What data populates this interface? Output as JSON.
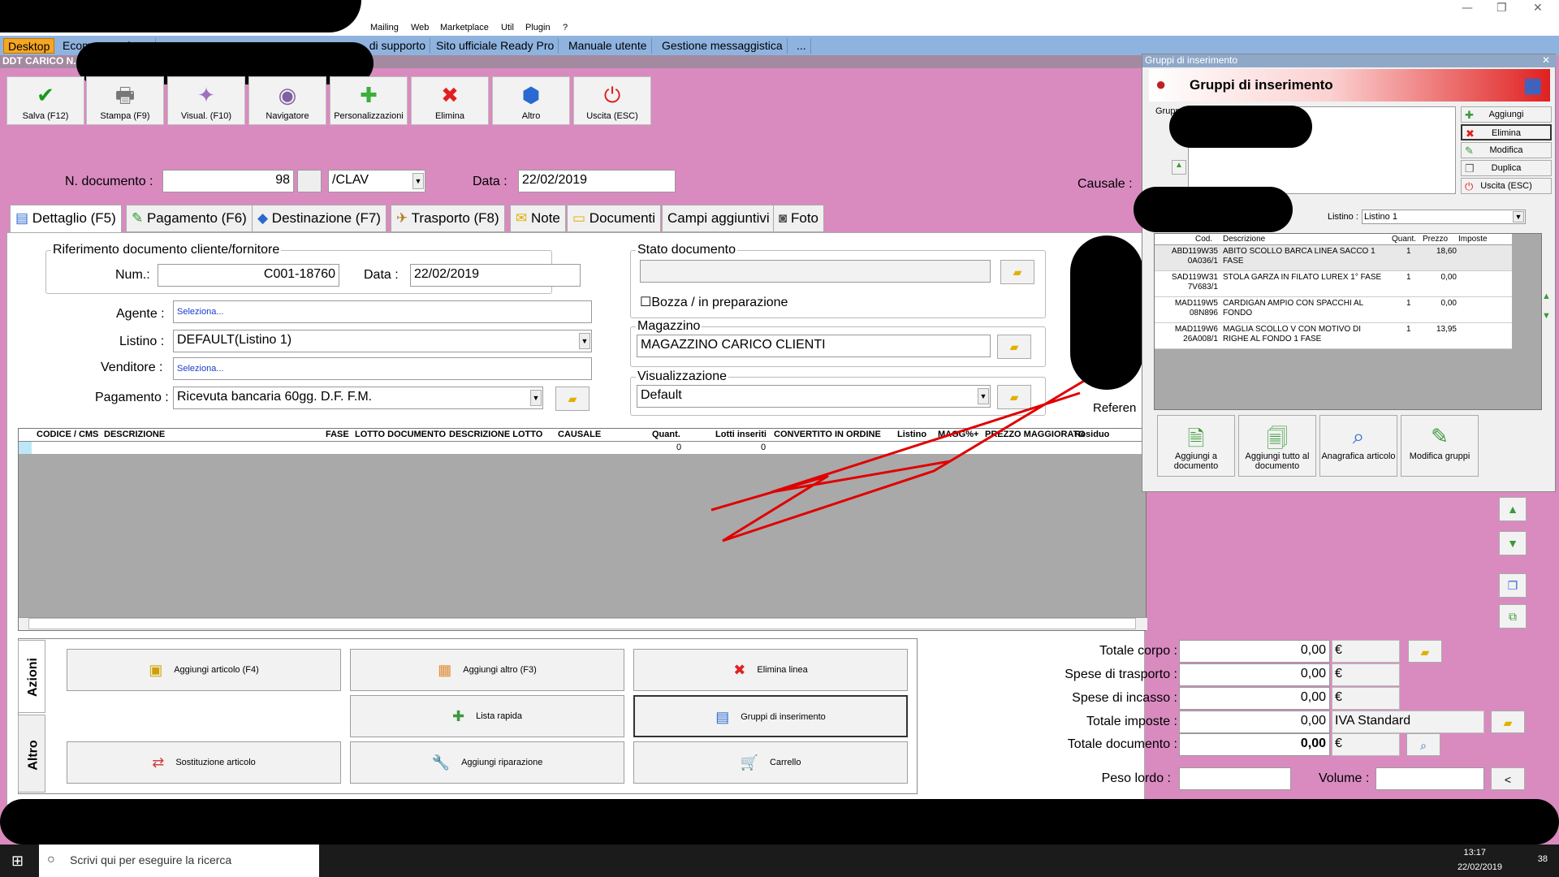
{
  "menu": {
    "items": [
      "Mailing",
      "Web",
      "Marketplace",
      "Util",
      "Plugin",
      "?"
    ]
  },
  "app_tabs": [
    "Desktop",
    "Ecommerce",
    "Supporto di supporto",
    "Sito ufficiale Ready Pro",
    "Manuale utente",
    "Gestione messaggistica",
    "..."
  ],
  "app_tab_labels": {
    "desktop": "Desktop",
    "ecommerce": "Ecommerce / ...",
    "supporto": "... di supporto",
    "sito": "Sito ufficiale Ready Pro",
    "manuale": "Manuale utente",
    "messaggi": "Gestione messaggistica",
    "more": "..."
  },
  "doc_label": "DDT CARICO N.",
  "toolbar": {
    "save": "Salva (F12)",
    "print": "Stampa (F9)",
    "view": "Visual. (F10)",
    "nav": "Navigatore",
    "custom": "Personalizzazioni",
    "delete": "Elimina",
    "other": "Altro",
    "exit": "Uscita (ESC)"
  },
  "header": {
    "num_label": "N. documento :",
    "num_value": "98",
    "series": "/CLAV",
    "date_label": "Data :",
    "date_value": "22/02/2019",
    "causale_label": "Causale :"
  },
  "doc_tabs": [
    "Dettaglio (F5)",
    "Pagamento (F6)",
    "Destinazione (F7)",
    "Trasporto (F8)",
    "Note",
    "Documenti",
    "Campi aggiuntivi",
    "Foto"
  ],
  "rif": {
    "title": "Riferimento documento cliente/fornitore",
    "num_label": "Num.:",
    "num_value": "C001-18760",
    "date_label": "Data :",
    "date_value": "22/02/2019"
  },
  "form": {
    "agente_label": "Agente :",
    "agente_value": "Seleziona...",
    "listino_label": "Listino :",
    "listino_value": "DEFAULT(Listino 1)",
    "venditore_label": "Venditore :",
    "venditore_value": "Seleziona...",
    "pagamento_label": "Pagamento :",
    "pagamento_value": "Ricevuta bancaria 60gg. D.F. F.M."
  },
  "stato": {
    "title": "Stato documento",
    "bozza": "Bozza / in preparazione"
  },
  "magazzino": {
    "title": "Magazzino",
    "value": "MAGAZZINO CARICO CLIENTI"
  },
  "visual": {
    "title": "Visualizzazione",
    "value": "Default"
  },
  "referen": "Referen",
  "grid": {
    "headers": [
      "CODICE / CMS",
      "DESCRIZIONE",
      "FASE",
      "LOTTO DOCUMENTO",
      "DESCRIZIONE LOTTO",
      "CAUSALE",
      "Quant.",
      "Lotti inseriti",
      "CONVERTITO IN ORDINE",
      "Listino",
      "MAGG%+",
      "PREZZO MAGGIORATO",
      "Residuo"
    ],
    "row_quant": "0",
    "row_lotti": "0"
  },
  "actions": {
    "tab_azioni": "Azioni",
    "tab_altro": "Altro",
    "add_article": "Aggiungi articolo (F4)",
    "add_other": "Aggiungi altro (F3)",
    "delete_line": "Elimina linea",
    "quick_list": "Lista rapida",
    "insert_groups": "Gruppi di inserimento",
    "substitute": "Sostituzione articolo",
    "add_repair": "Aggiungi riparazione",
    "cart": "Carrello"
  },
  "totals": {
    "corpo_label": "Totale corpo :",
    "corpo": "0,00",
    "trasporto_label": "Spese di trasporto :",
    "trasporto": "0,00",
    "incasso_label": "Spese di incasso :",
    "incasso": "0,00",
    "imposte_label": "Totale imposte :",
    "imposte": "0,00",
    "iva": "IVA Standard",
    "documento_label": "Totale documento :",
    "documento": "0,00",
    "currency": "€",
    "peso_label": "Peso lordo :",
    "volume_label": "Volume :",
    "lt": "<"
  },
  "popup": {
    "window_title": "Gruppi di inserimento",
    "title": "Gruppi di inserimento",
    "gruppi_label": "Grupp",
    "add": "Aggiungi",
    "delete": "Elimina",
    "edit": "Modifica",
    "duplicate": "Duplica",
    "exit": "Uscita (ESC)",
    "listino_label": "Listino :",
    "listino_value": "Listino 1",
    "table_headers": [
      "Cod.",
      "Descrizione",
      "Quant.",
      "Prezzo",
      "Imposte"
    ],
    "rows": [
      {
        "cod": "ABD119W35 0A036/1",
        "desc": "ABITO SCOLLO BARCA LINEA SACCO 1 FASE",
        "qty": "1",
        "price": "18,60"
      },
      {
        "cod": "SAD119W31 7V683/1",
        "desc": "STOLA GARZA IN FILATO LUREX 1° FASE",
        "qty": "1",
        "price": "0,00"
      },
      {
        "cod": "MAD119W5 08N896",
        "desc": "CARDIGAN AMPIO CON SPACCHI AL FONDO",
        "qty": "1",
        "price": "0,00"
      },
      {
        "cod": "MAD119W6 26A008/1",
        "desc": "MAGLIA SCOLLO V CON MOTIVO DI RIGHE AL FONDO 1 FASE",
        "qty": "1",
        "price": "13,95"
      }
    ],
    "add_to_doc": "Aggiungi a documento",
    "add_all": "Aggiungi tutto al documento",
    "anagrafica": "Anagrafica articolo",
    "edit_groups": "Modifica gruppi"
  },
  "taskbar": {
    "search": "Scrivi qui per eseguire la ricerca",
    "time": "13:17",
    "date": "22/02/2019",
    "badge": "38"
  },
  "colors": {
    "background": "#d98bc0",
    "tab_active": "#f5a623",
    "tabstrip": "#8fb3df",
    "arrow": "#e00000"
  }
}
